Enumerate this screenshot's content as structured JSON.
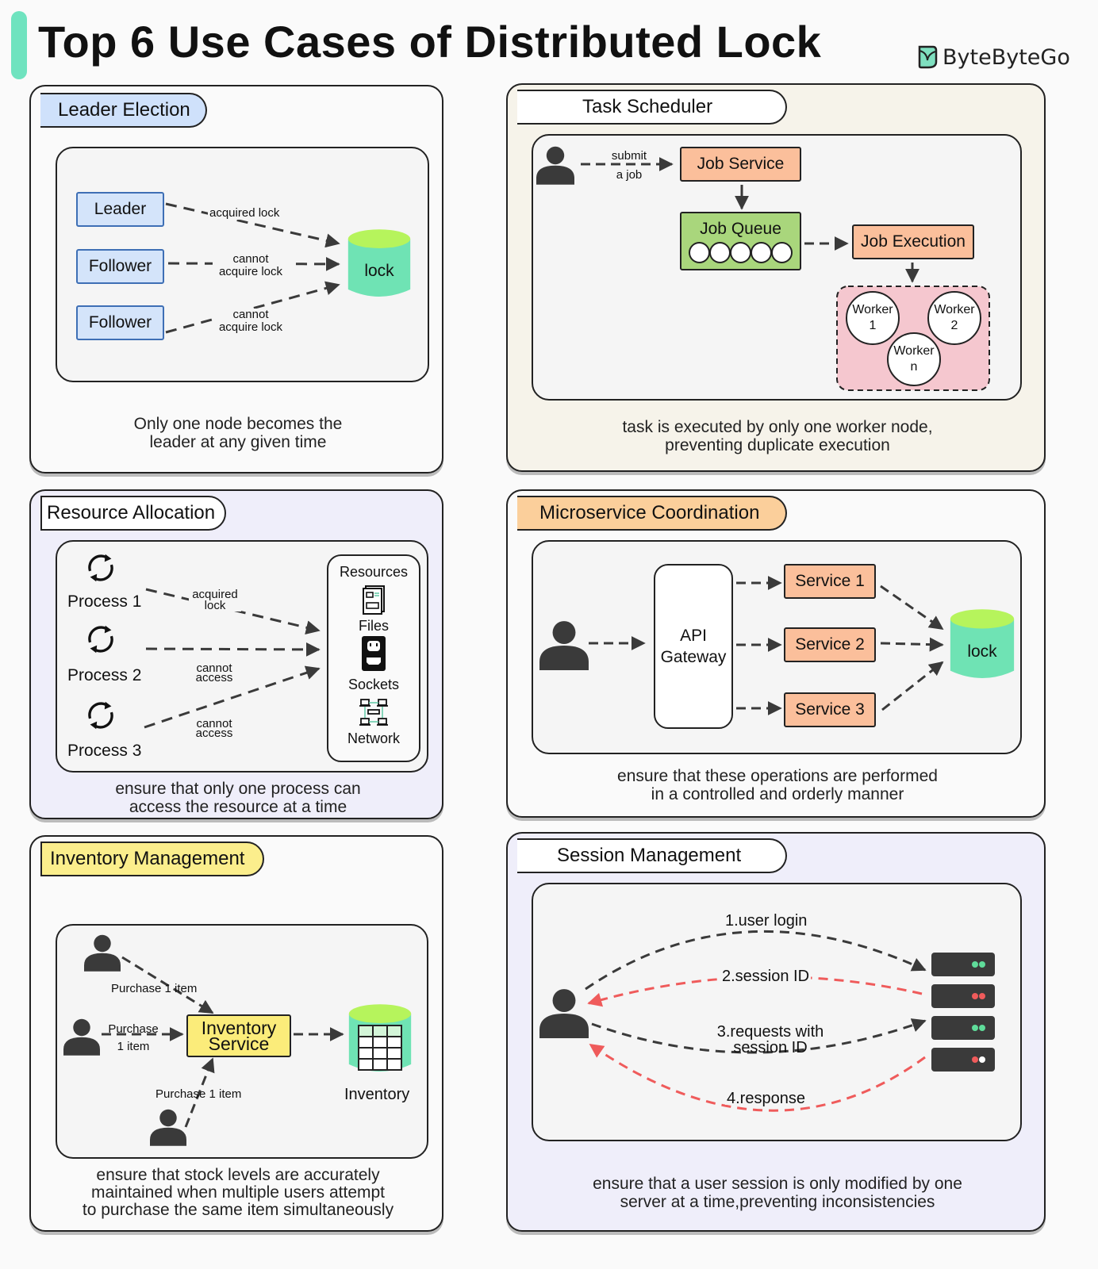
{
  "title": "Top 6 Use Cases of Distributed Lock",
  "brand": {
    "name": "ByteByteGo",
    "icon": "bytebytego-logo-icon"
  },
  "colors": {
    "accent": "#6fe3bf",
    "lock_top": "#b6f45c",
    "lock_body": "#6fe3b4",
    "orange": "#fbbf9b",
    "red_arrow": "#ef5b5b",
    "blue": "#cfe1fb",
    "yellow": "#fbec7a",
    "green": "#a9d67c",
    "pink": "#f5c7cf"
  },
  "leader_election": {
    "title": "Leader Election",
    "nodes": [
      "Leader",
      "Follower",
      "Follower"
    ],
    "edge_labels": [
      "acquired lock",
      "cannot acquire lock",
      "cannot acquire lock"
    ],
    "lock_label": "lock",
    "caption_lines": [
      "Only one node becomes the",
      "leader at any given time"
    ]
  },
  "task_scheduler": {
    "title": "Task Scheduler",
    "submit_label_lines": [
      "submit",
      "a job"
    ],
    "job_service": "Job Service",
    "job_queue": "Job Queue",
    "job_execution": "Job Execution",
    "workers": [
      {
        "line1": "Worker",
        "line2": "1"
      },
      {
        "line1": "Worker",
        "line2": "2"
      },
      {
        "line1": "Worker",
        "line2": "n"
      }
    ],
    "caption_lines": [
      "task is executed by only one worker node,",
      "preventing duplicate execution"
    ]
  },
  "resource_allocation": {
    "title": "Resource Allocation",
    "processes": [
      "Process 1",
      "Process 2",
      "Process 3"
    ],
    "edge_labels": [
      {
        "line1": "acquired",
        "line2": "lock"
      },
      {
        "line1": "cannot",
        "line2": "access"
      },
      {
        "line1": "cannot",
        "line2": "access"
      }
    ],
    "resources_title": "Resources",
    "resources": [
      {
        "label": "Files",
        "icon": "file-document-icon"
      },
      {
        "label": "Sockets",
        "icon": "power-socket-icon"
      },
      {
        "label": "Network",
        "icon": "network-icon"
      }
    ],
    "caption_lines": [
      "ensure that only one process can",
      "access the resource at a time"
    ]
  },
  "microservice_coordination": {
    "title": "Microservice Coordination",
    "gateway_lines": [
      "API",
      "Gateway"
    ],
    "services": [
      "Service 1",
      "Service 2",
      "Service 3"
    ],
    "lock_label": "lock",
    "caption_lines": [
      "ensure that these operations are performed",
      "in a controlled and orderly manner"
    ]
  },
  "inventory_management": {
    "title": "Inventory Management",
    "edge_labels": {
      "top": "Purchase 1 item",
      "left_lines": [
        "Purchase",
        "1 item"
      ],
      "bottom": "Purchase 1 item"
    },
    "service_lines": [
      "Inventory",
      "Service"
    ],
    "inventory_label": "Inventory",
    "caption_lines": [
      "ensure that stock levels are accurately",
      "maintained when multiple users attempt",
      "to purchase the same item simultaneously"
    ]
  },
  "session_management": {
    "title": "Session Management",
    "steps": [
      "1.user login",
      "2.session ID",
      "3.requests with",
      "session ID",
      "4.response"
    ],
    "servers": [
      {
        "led1": "#5fdc9a",
        "led2": "#5fdc9a"
      },
      {
        "led1": "#ef5b5b",
        "led2": "#ef5b5b"
      },
      {
        "led1": "#5fdc9a",
        "led2": "#5fdc9a"
      },
      {
        "led1": "#ef5b5b",
        "led2": "#ffffff"
      }
    ],
    "caption_lines": [
      "ensure that a user session is only modified by one",
      "server at a time,preventing inconsistencies"
    ]
  }
}
